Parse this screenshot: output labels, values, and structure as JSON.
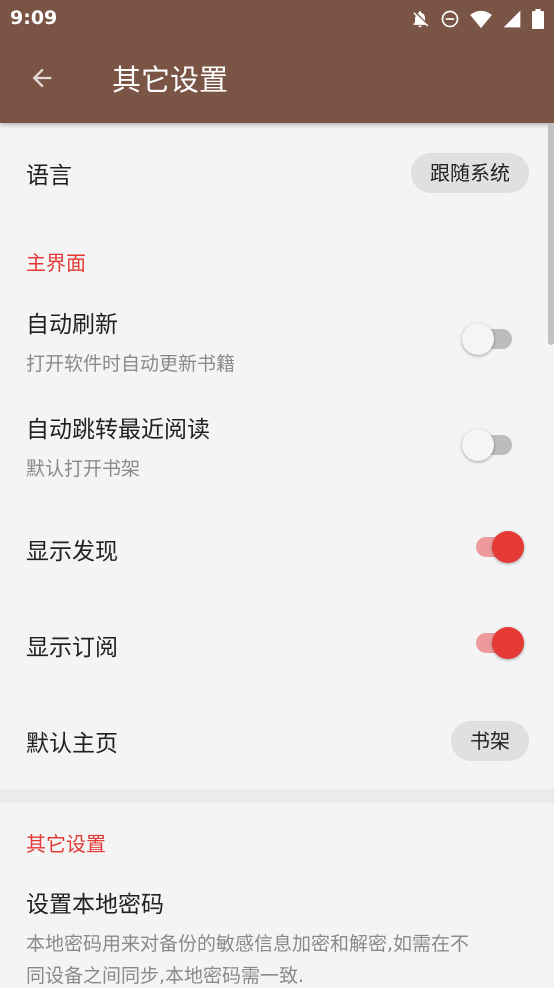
{
  "status_bar": {
    "time": "9:09",
    "icons": [
      "notifications-off-icon",
      "do-not-disturb-icon",
      "wifi-icon",
      "signal-icon",
      "battery-icon"
    ]
  },
  "app_bar": {
    "title": "其它设置",
    "back_icon": "arrow-back-icon",
    "color": "#7a5546"
  },
  "accent_color": "#e53935",
  "settings": {
    "language": {
      "label": "语言",
      "value": "跟随系统"
    },
    "main_ui": {
      "header": "主界面",
      "auto_refresh": {
        "label": "自动刷新",
        "summary": "打开软件时自动更新书籍",
        "enabled": false
      },
      "auto_jump_recent": {
        "label": "自动跳转最近阅读",
        "summary": "默认打开书架",
        "enabled": false
      },
      "show_discovery": {
        "label": "显示发现",
        "enabled": true
      },
      "show_subscription": {
        "label": "显示订阅",
        "enabled": true
      },
      "default_home": {
        "label": "默认主页",
        "value": "书架"
      }
    },
    "other": {
      "header": "其它设置",
      "local_password": {
        "label": "设置本地密码",
        "summary_line1": "本地密码用来对备份的敏感信息加密和解密,如需在不",
        "summary_line2": "同设备之间同步,本地密码需一致."
      }
    }
  }
}
